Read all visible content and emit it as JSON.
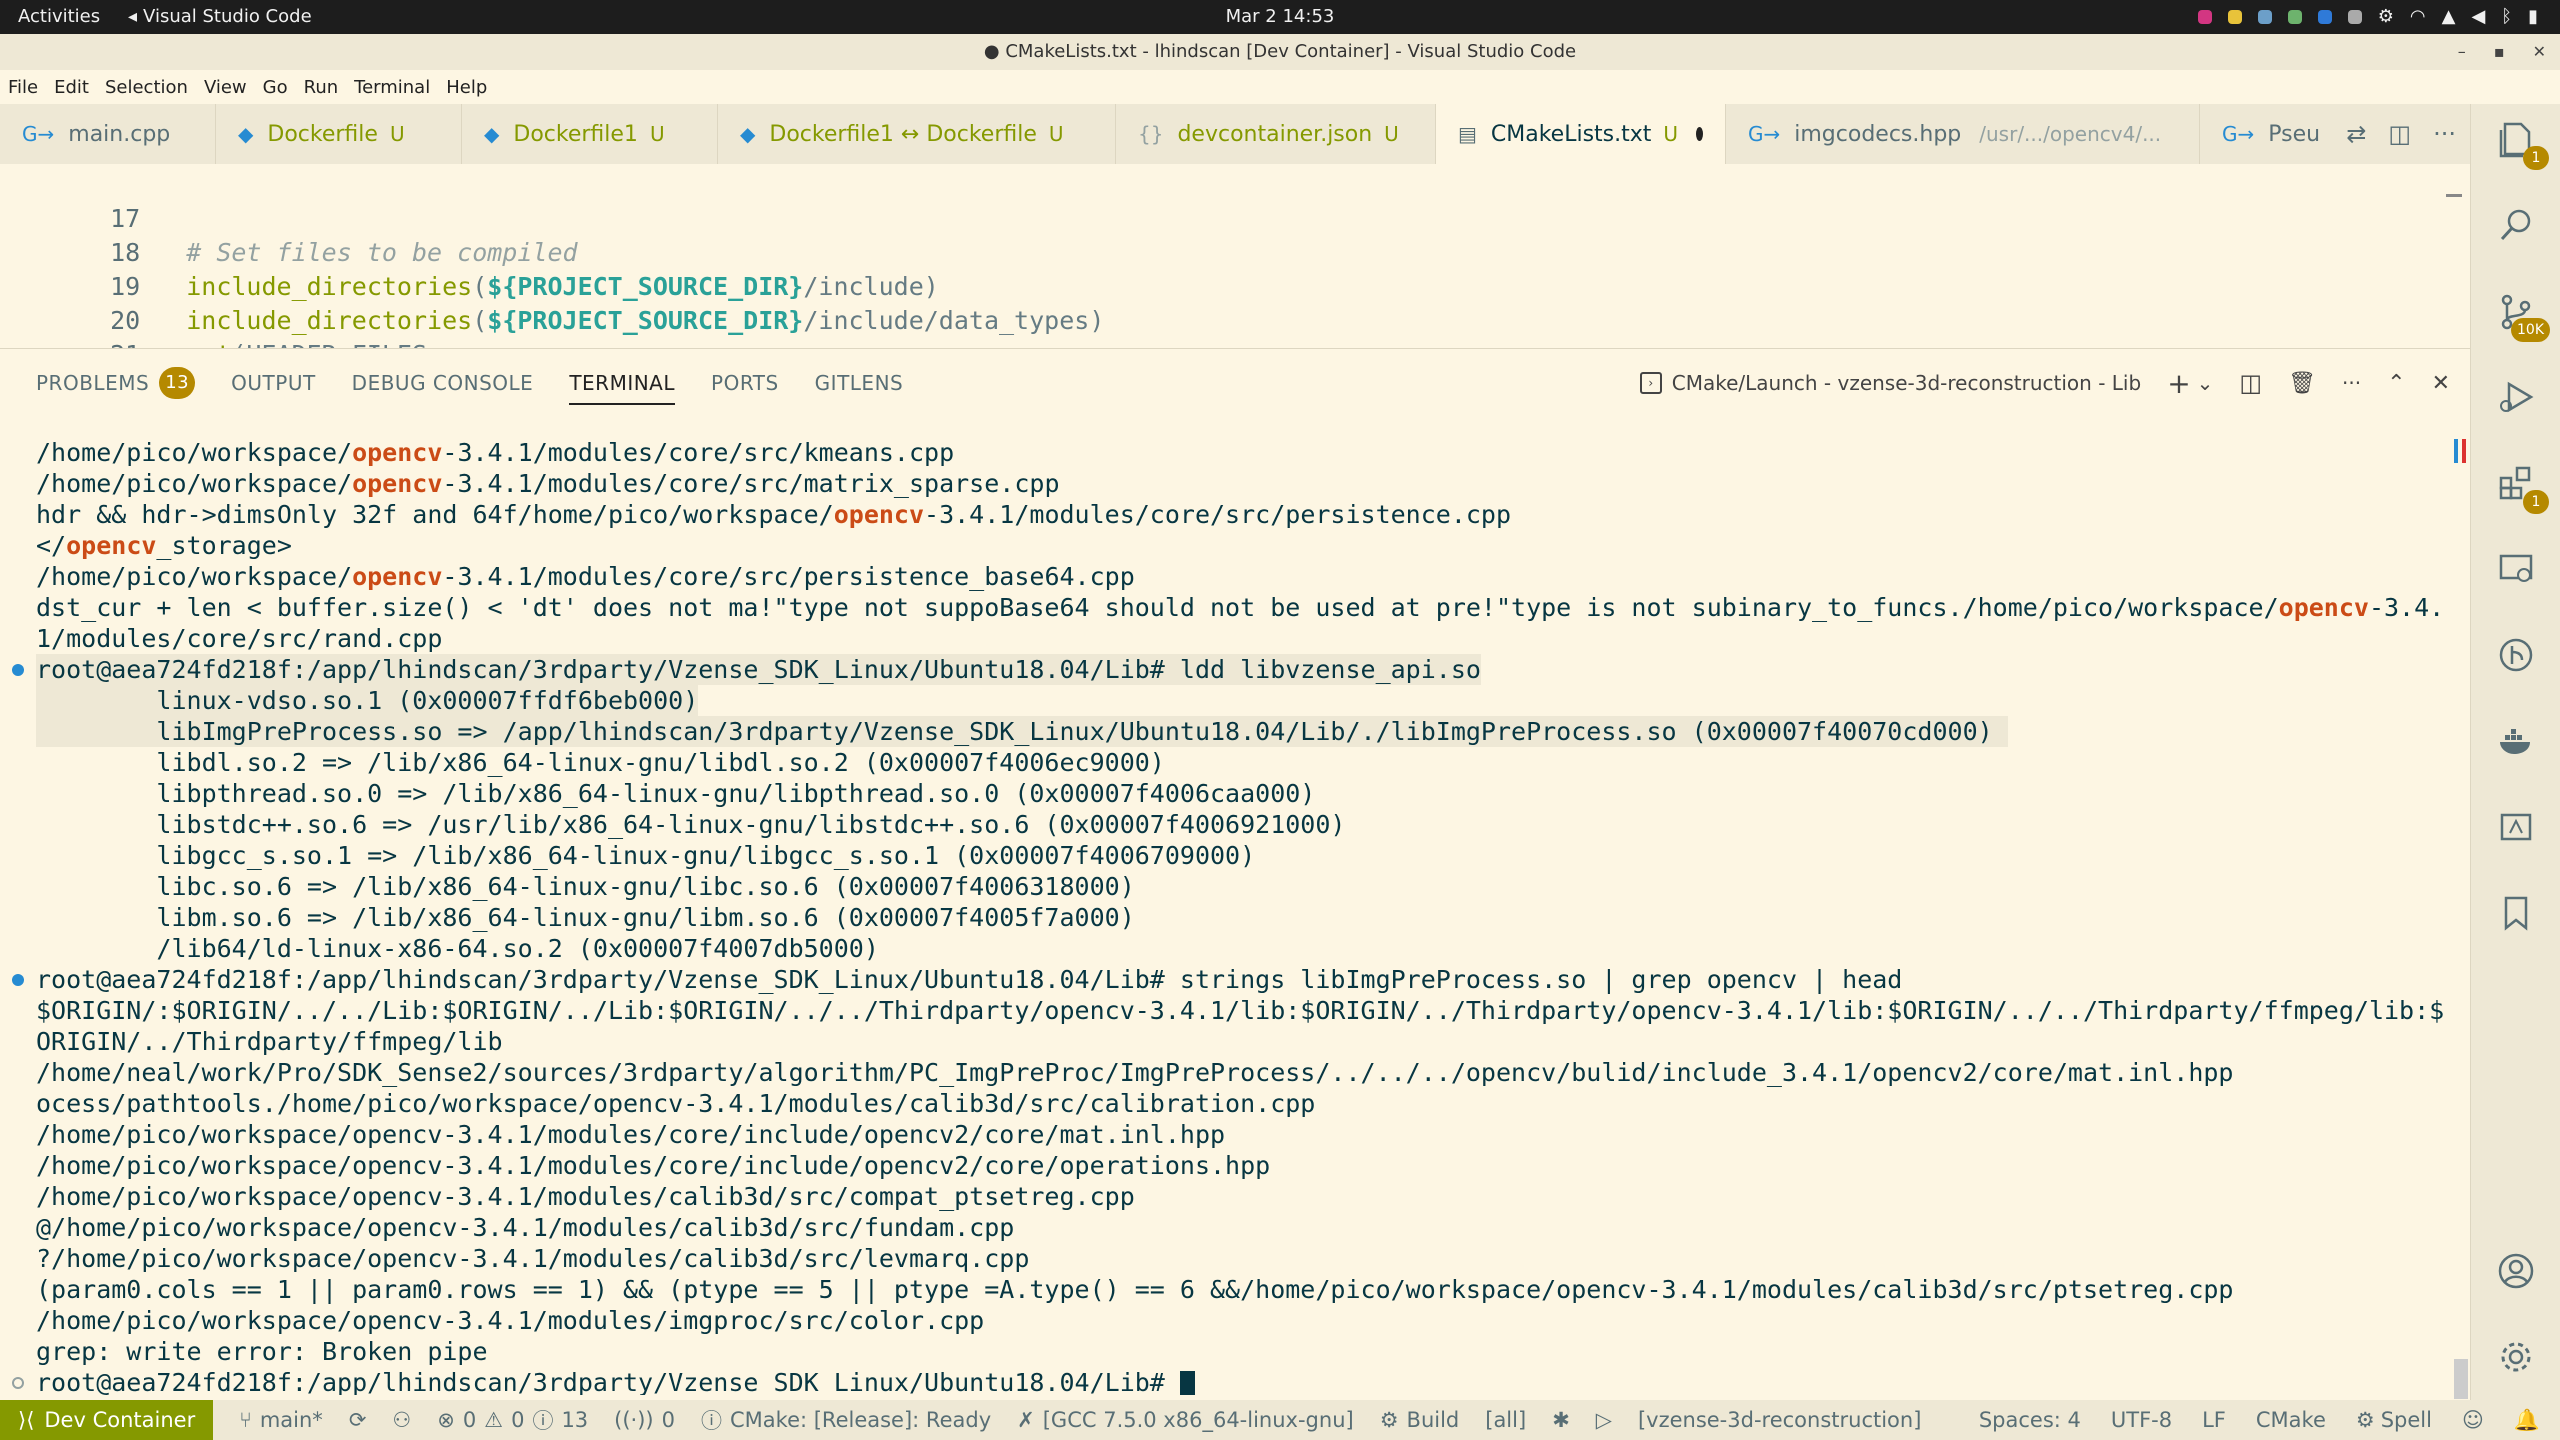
{
  "topbar": {
    "activities": "Activities",
    "app_name": "Visual Studio Code",
    "clock": "Mar 2  14:53"
  },
  "titlebar": {
    "title": "● CMakeLists.txt - lhindscan [Dev Container] - Visual Studio Code",
    "minimize": "–",
    "maximize": "▪",
    "close": "✕"
  },
  "menu": [
    "File",
    "Edit",
    "Selection",
    "View",
    "Go",
    "Run",
    "Terminal",
    "Help"
  ],
  "tabs": [
    {
      "label": "main.cpp",
      "status": ""
    },
    {
      "label": "Dockerfile",
      "status": "U"
    },
    {
      "label": "Dockerfile1",
      "status": "U"
    },
    {
      "label": "Dockerfile1 ↔ Dockerfile",
      "status": "U"
    },
    {
      "label": "devcontainer.json",
      "status": "U"
    },
    {
      "label": "CMakeLists.txt",
      "status": "U"
    },
    {
      "label": "imgcodecs.hpp",
      "path": "/usr/.../opencv4/..."
    },
    {
      "label": "Pseud"
    }
  ],
  "editor": {
    "lines": [
      {
        "num": "17"
      },
      {
        "num": "18",
        "comment": "# Set files to be compiled"
      },
      {
        "num": "19",
        "fn": "include_directories",
        "open": "(",
        "var": "${PROJECT_SOURCE_DIR}",
        "rest": "/include)"
      },
      {
        "num": "20",
        "fn": "include_directories",
        "open": "(",
        "var": "${PROJECT_SOURCE_DIR}",
        "rest": "/include/data_types)"
      },
      {
        "num": "21",
        "fn": "set",
        "rest": "(HEADER_FILES"
      }
    ]
  },
  "panel": {
    "tabs": {
      "problems": "PROBLEMS",
      "problems_count": "13",
      "output": "OUTPUT",
      "debug_console": "DEBUG CONSOLE",
      "terminal": "TERMINAL",
      "ports": "PORTS",
      "gitlens": "GITLENS"
    },
    "terminal_name": "CMake/Launch - vzense-3d-reconstruction - Lib"
  },
  "terminal": {
    "lines": [
      {
        "a": "/home/pico/workspace/",
        "h": "opencv",
        "b": "-3.4.1/modules/core/src/kmeans.cpp"
      },
      {
        "a": "/home/pico/workspace/",
        "h": "opencv",
        "b": "-3.4.1/modules/core/src/matrix_sparse.cpp"
      },
      {
        "a": "hdr && hdr->dimsOnly 32f and 64f/home/pico/workspace/",
        "h": "opencv",
        "b": "-3.4.1/modules/core/src/persistence.cpp"
      },
      {
        "a": "</",
        "h": "opencv",
        "b": "_storage>"
      },
      {
        "a": "/home/pico/workspace/",
        "h": "opencv",
        "b": "-3.4.1/modules/core/src/persistence_base64.cpp"
      },
      {
        "a": "dst_cur + len < buffer.size() < 'dt' does not ma!\"type not suppoBase64 should not be used at pre!\"type is not subinary_to_funcs./home/pico/workspace/",
        "h": "opencv",
        "b": "-3.4."
      },
      {
        "a": "1/modules/core/src/rand.cpp"
      },
      {
        "a": "root@aea724fd218f:/app/lhindscan/3rdparty/Vzense_SDK_Linux/Ubuntu18.04/Lib# ldd libvzense_api.so",
        "mark": "dot",
        "sel": true
      },
      {
        "a": "        linux-vdso.so.1 (0x00007ffdf6beb000)",
        "sel": true
      },
      {
        "a": "        libImgPreProcess.so => /app/lhindscan/3rdparty/Vzense_SDK_Linux/Ubuntu18.04/Lib/./libImgPreProcess.so (0x00007f40070cd000) ",
        "sel": true
      },
      {
        "a": "        libdl.so.2 => /lib/x86_64-linux-gnu/libdl.so.2 (0x00007f4006ec9000)"
      },
      {
        "a": "        libpthread.so.0 => /lib/x86_64-linux-gnu/libpthread.so.0 (0x00007f4006caa000)"
      },
      {
        "a": "        libstdc++.so.6 => /usr/lib/x86_64-linux-gnu/libstdc++.so.6 (0x00007f4006921000)"
      },
      {
        "a": "        libgcc_s.so.1 => /lib/x86_64-linux-gnu/libgcc_s.so.1 (0x00007f4006709000)"
      },
      {
        "a": "        libc.so.6 => /lib/x86_64-linux-gnu/libc.so.6 (0x00007f4006318000)"
      },
      {
        "a": "        libm.so.6 => /lib/x86_64-linux-gnu/libm.so.6 (0x00007f4005f7a000)"
      },
      {
        "a": "        /lib64/ld-linux-x86-64.so.2 (0x00007f4007db5000)"
      },
      {
        "a": "root@aea724fd218f:/app/lhindscan/3rdparty/Vzense_SDK_Linux/Ubuntu18.04/Lib# strings libImgPreProcess.so | grep opencv | head",
        "mark": "dot"
      },
      {
        "a": "$ORIGIN/:$ORIGIN/../../Lib:$ORIGIN/../Lib:$ORIGIN/../../Thirdparty/opencv-3.4.1/lib:$ORIGIN/../Thirdparty/opencv-3.4.1/lib:$ORIGIN/../../Thirdparty/ffmpeg/lib:$"
      },
      {
        "a": "ORIGIN/../Thirdparty/ffmpeg/lib"
      },
      {
        "a": "/home/neal/work/Pro/SDK_Sense2/sources/3rdparty/algorithm/PC_ImgPreProc/ImgPreProcess/../../../opencv/bulid/include_3.4.1/opencv2/core/mat.inl.hpp"
      },
      {
        "a": "ocess/pathtools./home/pico/workspace/opencv-3.4.1/modules/calib3d/src/calibration.cpp"
      },
      {
        "a": "/home/pico/workspace/opencv-3.4.1/modules/core/include/opencv2/core/mat.inl.hpp"
      },
      {
        "a": "/home/pico/workspace/opencv-3.4.1/modules/core/include/opencv2/core/operations.hpp"
      },
      {
        "a": "/home/pico/workspace/opencv-3.4.1/modules/calib3d/src/compat_ptsetreg.cpp"
      },
      {
        "a": "@/home/pico/workspace/opencv-3.4.1/modules/calib3d/src/fundam.cpp"
      },
      {
        "a": "?/home/pico/workspace/opencv-3.4.1/modules/calib3d/src/levmarq.cpp"
      },
      {
        "a": "(param0.cols == 1 || param0.rows == 1) && (ptype == 5 || ptype =A.type() == 6 &&/home/pico/workspace/opencv-3.4.1/modules/calib3d/src/ptsetreg.cpp"
      },
      {
        "a": "/home/pico/workspace/opencv-3.4.1/modules/imgproc/src/color.cpp"
      },
      {
        "a": "grep: write error: Broken pipe"
      },
      {
        "a": "root@aea724fd218f:/app/lhindscan/3rdparty/Vzense_SDK_Linux/Ubuntu18.04/Lib# ",
        "mark": "empty",
        "cursor": true
      }
    ]
  },
  "activitybar": {
    "explorer_badge": "1",
    "scm_badge": "10K",
    "extensions_badge": "1"
  },
  "statusbar": {
    "remote": "Dev Container",
    "branch": "main*",
    "errors": "0",
    "warnings": "0",
    "infos": "13",
    "ports": "0",
    "cmake_status": "CMake: [Release]: Ready",
    "kit": "[GCC 7.5.0 x86_64-linux-gnu]",
    "build": "Build",
    "target": "[all]",
    "project": "[vzense-3d-reconstruction]",
    "spaces": "Spaces: 4",
    "encoding": "UTF-8",
    "eol": "LF",
    "language": "CMake",
    "spell": "Spell"
  },
  "colors": {
    "background": "#fdf6e3",
    "chrome": "#eee8d5",
    "accent_green": "#859900",
    "accent_blue": "#268bd2",
    "highlight_orange": "#cb4b16",
    "badge": "#b58900"
  }
}
